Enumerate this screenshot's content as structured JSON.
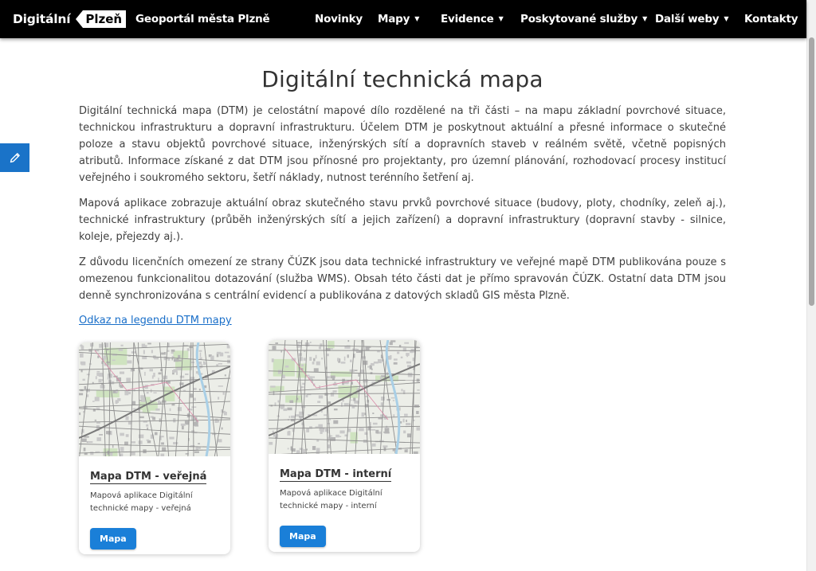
{
  "header": {
    "logo_word": "Digitální",
    "logo_badge": "Plzeň",
    "site_title": "Geoportál města Plzně",
    "nav": [
      {
        "label": "Novinky",
        "dropdown": false
      },
      {
        "label": "Mapy",
        "dropdown": true
      },
      {
        "label": "Evidence",
        "dropdown": true
      },
      {
        "label": "Poskytované služby",
        "dropdown": true
      },
      {
        "label": "Další weby",
        "dropdown": true
      },
      {
        "label": "Kontakty",
        "dropdown": false
      }
    ],
    "caret": "▼"
  },
  "feedback": {
    "icon": "pencil-icon"
  },
  "main": {
    "title": "Digitální technická mapa",
    "paragraphs": [
      "Digitální technická mapa (DTM) je celostátní mapové dílo rozdělené na tři části – na mapu základní povrchové situace, technickou infrastrukturu a dopravní infrastrukturu. Účelem DTM je poskytnout aktuální a přesné informace o skutečné poloze a stavu objektů povrchové situace, inženýrských sítí a dopravních staveb v reálném světě, včetně popisných atributů. Informace získané z dat DTM jsou přínosné pro projektanty, pro územní plánování, rozhodovací procesy institucí veřejného i soukromého sektoru, šetří náklady, nutnost terénního šetření aj.",
      "Mapová aplikace zobrazuje aktuální obraz skutečného stavu prvků povrchové situace (budovy, ploty, chodníky, zeleň aj.), technické infrastruktury (průběh inženýrských sítí a jejich zařízení) a dopravní infrastruktury (dopravní stavby - silnice, koleje, přejezdy aj.).",
      "Z důvodu licenčních omezení ze strany ČÚZK jsou data technické infrastruktury ve veřejné mapě DTM publikována pouze s omezenou funkcionalitou dotazování (služba WMS). Obsah této části dat je přímo spravován ČÚZK. Ostatní data DTM jsou denně synchronizována s centrální evidencí a publikována z datových skladů GIS města Plzně."
    ],
    "legend_link": "Odkaz na legendu DTM mapy"
  },
  "cards": [
    {
      "title": "Mapa DTM - veřejná",
      "desc": "Mapová aplikace Digitální technické mapy - veřejná",
      "button": "Mapa"
    },
    {
      "title": "Mapa DTM - interní",
      "desc": "Mapová aplikace Digitální technické mapy - interní",
      "button": "Mapa"
    }
  ],
  "colors": {
    "header_bg": "#000000",
    "accent": "#1a7fd8",
    "link": "#1a6fc9"
  }
}
